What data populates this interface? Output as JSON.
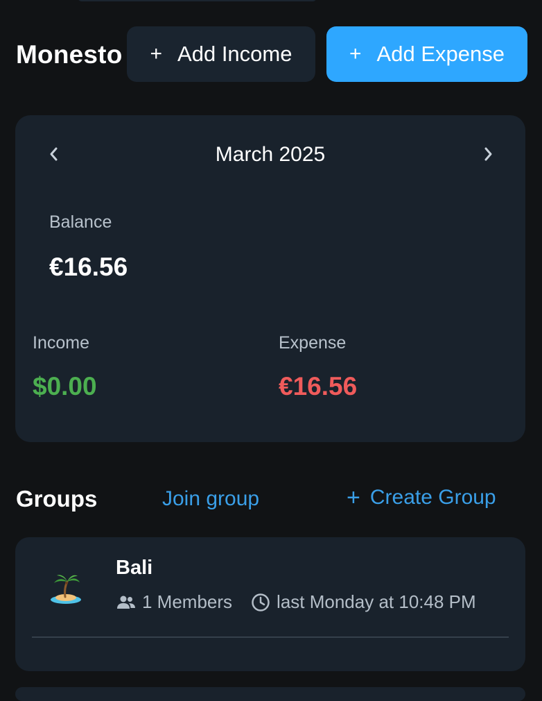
{
  "app": {
    "title": "Monesto"
  },
  "header": {
    "add_income_label": "Add Income",
    "add_expense_label": "Add Expense",
    "plus_glyph": "+"
  },
  "summary": {
    "month": "March 2025",
    "balance_label": "Balance",
    "balance_value": "€16.56",
    "income_label": "Income",
    "income_value": "$0.00",
    "expense_label": "Expense",
    "expense_value": "€16.56"
  },
  "groups": {
    "title": "Groups",
    "join_label": "Join group",
    "create_label": "Create Group",
    "create_plus": "+",
    "items": [
      {
        "name": "Bali",
        "icon": "desert-island-icon",
        "members": "1 Members",
        "last_activity": "last Monday at 10:48 PM"
      }
    ]
  },
  "colors": {
    "background": "#111315",
    "card": "#19222c",
    "accent": "#2ea7ff",
    "link": "#3a9fe8",
    "income": "#4caf50",
    "expense": "#ef5b5b"
  }
}
